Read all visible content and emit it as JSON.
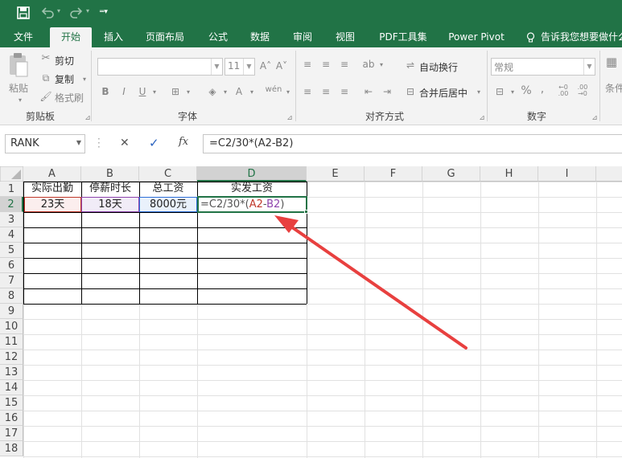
{
  "colors": {
    "accent": "#217346",
    "arrow": "#e8403f",
    "ref_a2": "#c0392b",
    "ref_b2": "#8e44ad",
    "ref_c2": "#2e6fd8"
  },
  "tabs": [
    "文件",
    "开始",
    "插入",
    "页面布局",
    "公式",
    "数据",
    "审阅",
    "视图",
    "PDF工具集",
    "Power Pivot"
  ],
  "tell_me": "告诉我您想要做什么",
  "ribbon": {
    "paste": "粘贴",
    "cut": "剪切",
    "copy": "复制",
    "format_painter": "格式刷",
    "clipboard": "剪贴板",
    "font_size": "11",
    "font": "字体",
    "wrap_text": "自动换行",
    "merge_center": "合并后居中",
    "alignment": "对齐方式",
    "number_format": "常规",
    "number": "数字",
    "percent": "%",
    "comma": ",",
    "conditional": "条件"
  },
  "formula_bar": {
    "name_box": "RANK",
    "cancel": "✕",
    "enter": "✓",
    "fx": "fx",
    "formula": "=C2/30*(A2-B2)"
  },
  "sheet": {
    "columns": [
      "A",
      "B",
      "C",
      "D",
      "E",
      "F",
      "G",
      "H",
      "I"
    ],
    "rows": [
      "1",
      "2",
      "3",
      "4",
      "5",
      "6",
      "7",
      "8",
      "9",
      "10",
      "11",
      "12",
      "13",
      "14",
      "15",
      "16",
      "17",
      "18"
    ],
    "header_row": [
      "实际出勤",
      "停薪时长",
      "总工资",
      "实发工资"
    ],
    "data_row": [
      "23天",
      "18天",
      "8000元"
    ],
    "formula_parts": [
      "=C2/30*(",
      "A2",
      "-",
      "B2",
      ")"
    ]
  }
}
